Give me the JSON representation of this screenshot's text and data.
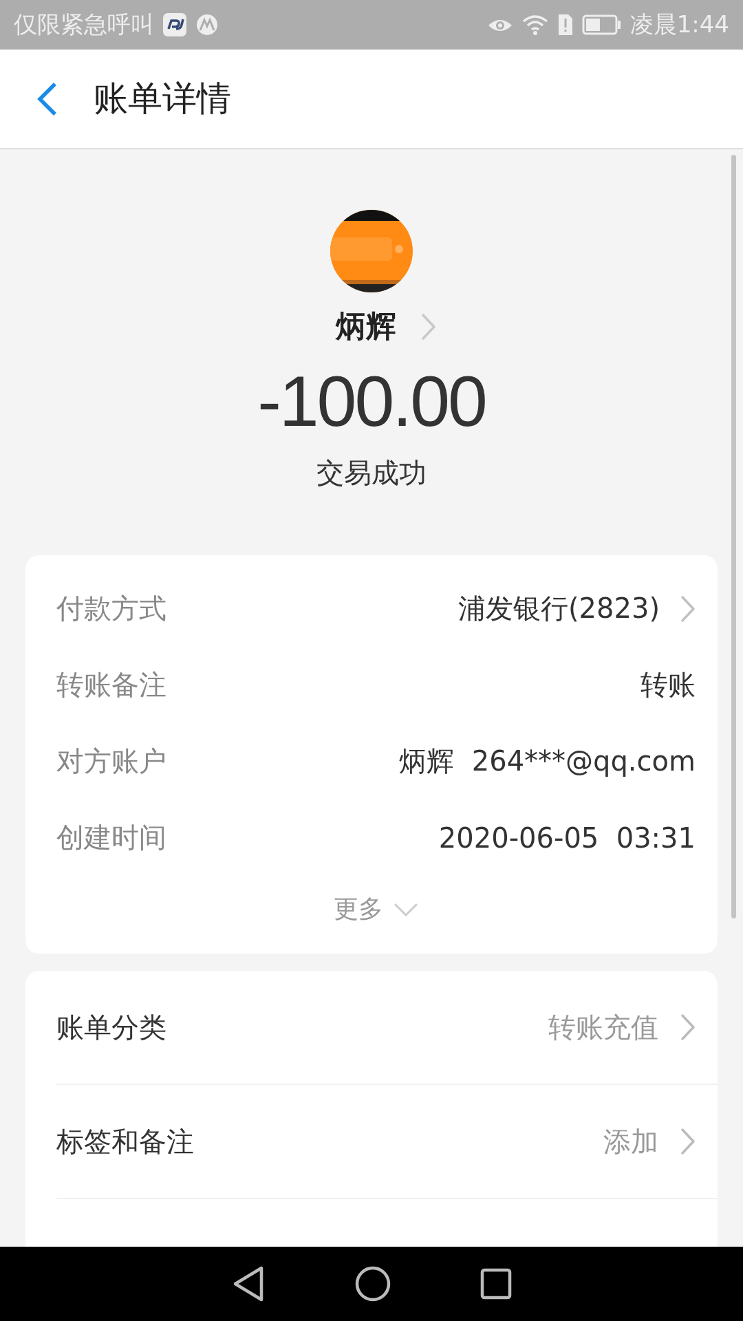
{
  "status_bar": {
    "carrier": "仅限紧急呼叫",
    "time": "凌晨1:44"
  },
  "header": {
    "title": "账单详情"
  },
  "payee": {
    "name": "炳辉",
    "amount": "-100.00",
    "status": "交易成功"
  },
  "details": {
    "rows": [
      {
        "label": "付款方式",
        "value": "浦发银行(2823)",
        "link": true
      },
      {
        "label": "转账备注",
        "value": "转账",
        "link": false
      },
      {
        "label": "对方账户",
        "value": "炳辉  264***@qq.com",
        "link": false
      },
      {
        "label": "创建时间",
        "value": "2020-06-05  03:31",
        "link": false
      }
    ],
    "more": "更多"
  },
  "actions": [
    {
      "label": "账单分类",
      "value": "转账充值"
    },
    {
      "label": "标签和备注",
      "value": "添加"
    }
  ]
}
